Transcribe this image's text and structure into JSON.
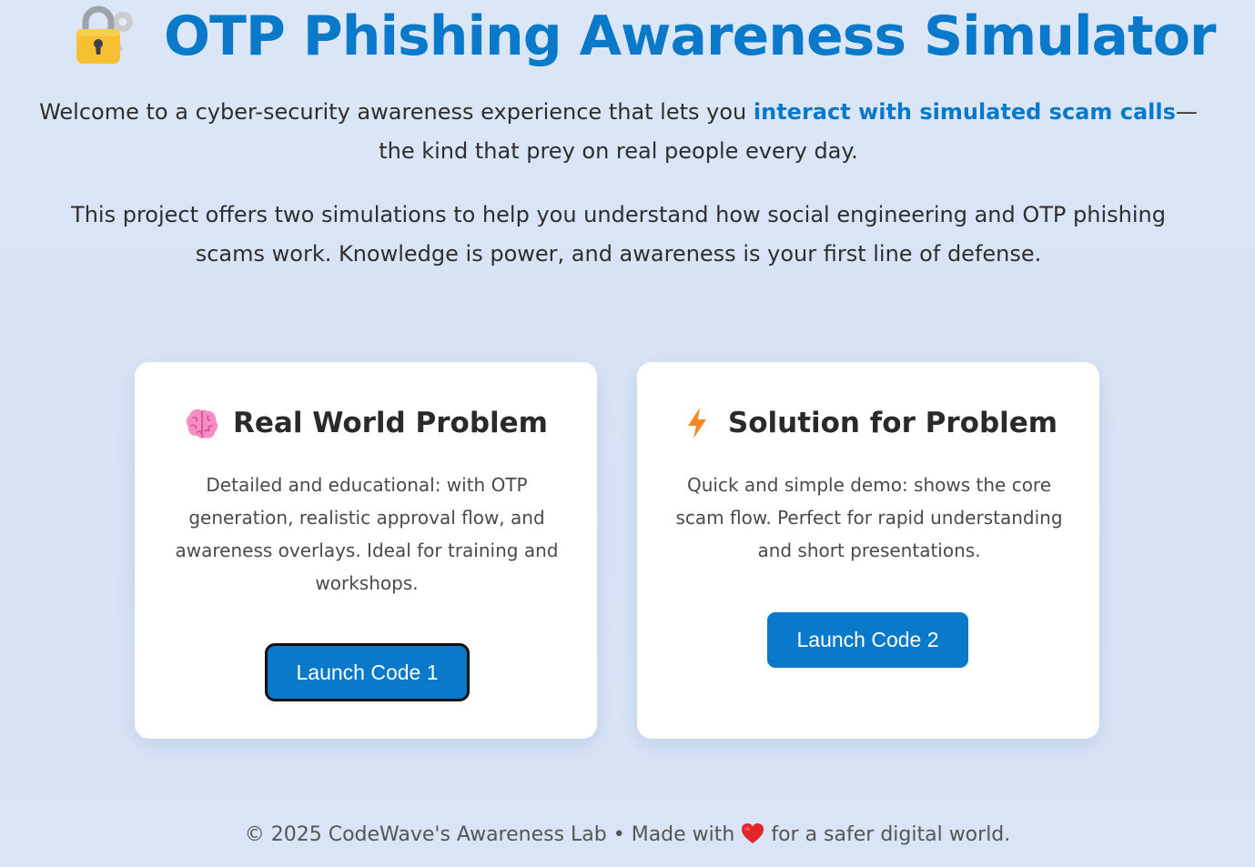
{
  "header": {
    "title": "OTP Phishing Awareness Simulator",
    "icon": "locked-with-key-icon"
  },
  "intro": {
    "p1_before": "Welcome to a cyber-security awareness experience that lets you ",
    "p1_highlight": "interact with simulated scam calls",
    "p1_after": "—the kind that prey on real people every day.",
    "p2": "This project offers two simulations to help you understand how social engineering and OTP phishing scams work. Knowledge is power, and awareness is your first line of defense."
  },
  "cards": [
    {
      "icon": "brain-icon",
      "title": "Real World Problem",
      "description": "Detailed and educational: with OTP generation, realistic approval flow, and awareness overlays. Ideal for training and workshops.",
      "button_label": "Launch Code 1"
    },
    {
      "icon": "lightning-icon",
      "title": "Solution for Problem",
      "description": "Quick and simple demo: shows the core scam flow. Perfect for rapid understanding and short presentations.",
      "button_label": "Launch Code 2"
    }
  ],
  "footer": {
    "before": "© 2025 CodeWave's Awareness Lab • Made with",
    "icon": "heart-icon",
    "after": "for a safer digital world."
  },
  "colors": {
    "accent": "#0a79c9",
    "background": "#d8e4f6",
    "card": "#ffffff"
  }
}
